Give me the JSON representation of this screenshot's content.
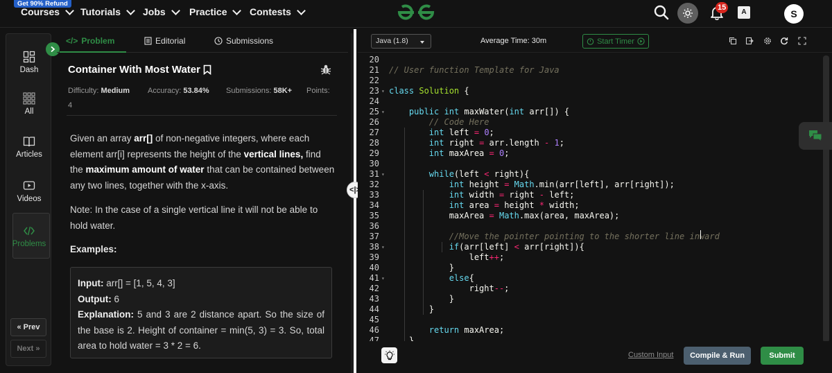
{
  "topnav": {
    "refund_badge": "Get 90% Refund",
    "items": [
      {
        "label": "Courses"
      },
      {
        "label": "Tutorials"
      },
      {
        "label": "Jobs"
      },
      {
        "label": "Practice"
      },
      {
        "label": "Contests"
      }
    ],
    "notification_count": "15",
    "avatar_letter": "S",
    "icons": [
      "search-icon",
      "theme-toggle-icon",
      "bell-icon",
      "translate-icon"
    ]
  },
  "rail": {
    "items": [
      {
        "label": "Dash",
        "icon": "dashboard-icon"
      },
      {
        "label": "All",
        "icon": "grid-icon"
      },
      {
        "label": "Articles",
        "icon": "book-icon"
      },
      {
        "label": "Videos",
        "icon": "video-icon"
      },
      {
        "label": "Problems",
        "icon": "code-icon"
      }
    ],
    "prev_label": "« Prev",
    "next_label": "Next »"
  },
  "tabs": [
    {
      "label": "Problem",
      "icon": "code-tag-icon",
      "active": true
    },
    {
      "label": "Editorial",
      "icon": "document-icon",
      "active": false
    },
    {
      "label": "Submissions",
      "icon": "clock-icon",
      "active": false
    }
  ],
  "problem": {
    "title": "Container With Most Water",
    "difficulty_label": "Difficulty:",
    "difficulty": "Medium",
    "accuracy_label": "Accuracy:",
    "accuracy": "53.84%",
    "submissions_label": "Submissions:",
    "submissions": "58K+",
    "points_label": "Points:",
    "points": "4",
    "description": {
      "p1": "Given an array ",
      "b1": "arr[]",
      "p2": " of non-negative integers, where each element arr[i] represents the height of the ",
      "b2": "vertical lines,",
      "p3": " find the ",
      "b3": "maximum amount of water",
      "p4": " that can be contained between any two lines, together with the x-axis."
    },
    "note": "Note: In the case of a single vertical line it will not be able to hold water.",
    "examples_heading": "Examples:",
    "example": {
      "input_label": "Input:",
      "input_value": "arr[] = [1, 5, 4, 3]",
      "output_label": "Output:",
      "output_value": "6",
      "explanation_label": "Explanation:",
      "explanation_value": "5 and 3 are 2 distance apart. So the size of the base is 2. Height of container = min(5, 3) = 3. So, total area to hold water = 3 * 2 = 6."
    }
  },
  "editor": {
    "language": "Java (1.8)",
    "average_time": "Average Time: 30m",
    "start_timer_label": "Start Timer",
    "toolbar_icons": [
      "copy-icon",
      "import-icon",
      "settings-icon",
      "reset-icon",
      "fullscreen-icon"
    ],
    "active_line": 37,
    "lines": [
      {
        "n": "20",
        "fold": false,
        "code": ""
      },
      {
        "n": "21",
        "fold": false,
        "code": "// User function Template for Java"
      },
      {
        "n": "22",
        "fold": false,
        "code": ""
      },
      {
        "n": "23",
        "fold": true,
        "code": "class Solution {"
      },
      {
        "n": "24",
        "fold": false,
        "code": ""
      },
      {
        "n": "25",
        "fold": true,
        "code": "    public int maxWater(int arr[]) {"
      },
      {
        "n": "26",
        "fold": false,
        "code": "        // Code Here"
      },
      {
        "n": "27",
        "fold": false,
        "code": "        int left = 0;"
      },
      {
        "n": "28",
        "fold": false,
        "code": "        int right = arr.length - 1;"
      },
      {
        "n": "29",
        "fold": false,
        "code": "        int maxArea = 0;"
      },
      {
        "n": "30",
        "fold": false,
        "code": ""
      },
      {
        "n": "31",
        "fold": true,
        "code": "        while(left < right){"
      },
      {
        "n": "32",
        "fold": false,
        "code": "            int height = Math.min(arr[left], arr[right]);"
      },
      {
        "n": "33",
        "fold": false,
        "code": "            int width = right - left;"
      },
      {
        "n": "34",
        "fold": false,
        "code": "            int area = height * width;"
      },
      {
        "n": "35",
        "fold": false,
        "code": "            maxArea = Math.max(area, maxArea);"
      },
      {
        "n": "36",
        "fold": false,
        "code": ""
      },
      {
        "n": "37",
        "fold": false,
        "code": "            //Move the pointer pointing to the shorter line inward"
      },
      {
        "n": "38",
        "fold": true,
        "code": "            if(arr[left] < arr[right]){"
      },
      {
        "n": "39",
        "fold": false,
        "code": "                left++;"
      },
      {
        "n": "40",
        "fold": false,
        "code": "            }"
      },
      {
        "n": "41",
        "fold": true,
        "code": "            else{"
      },
      {
        "n": "42",
        "fold": false,
        "code": "                right--;"
      },
      {
        "n": "43",
        "fold": false,
        "code": "            }"
      },
      {
        "n": "44",
        "fold": false,
        "code": "        }"
      },
      {
        "n": "45",
        "fold": false,
        "code": ""
      },
      {
        "n": "46",
        "fold": false,
        "code": "        return maxArea;"
      },
      {
        "n": "47",
        "fold": false,
        "code": "    }"
      }
    ]
  },
  "bottom": {
    "custom_input_label": "Custom Input",
    "compile_label": "Compile & Run",
    "submit_label": "Submit"
  },
  "colors": {
    "brand_green": "#2f8d46",
    "background": "#131313",
    "notification_red": "#d7261e",
    "compile_button": "#4c5f6f"
  }
}
